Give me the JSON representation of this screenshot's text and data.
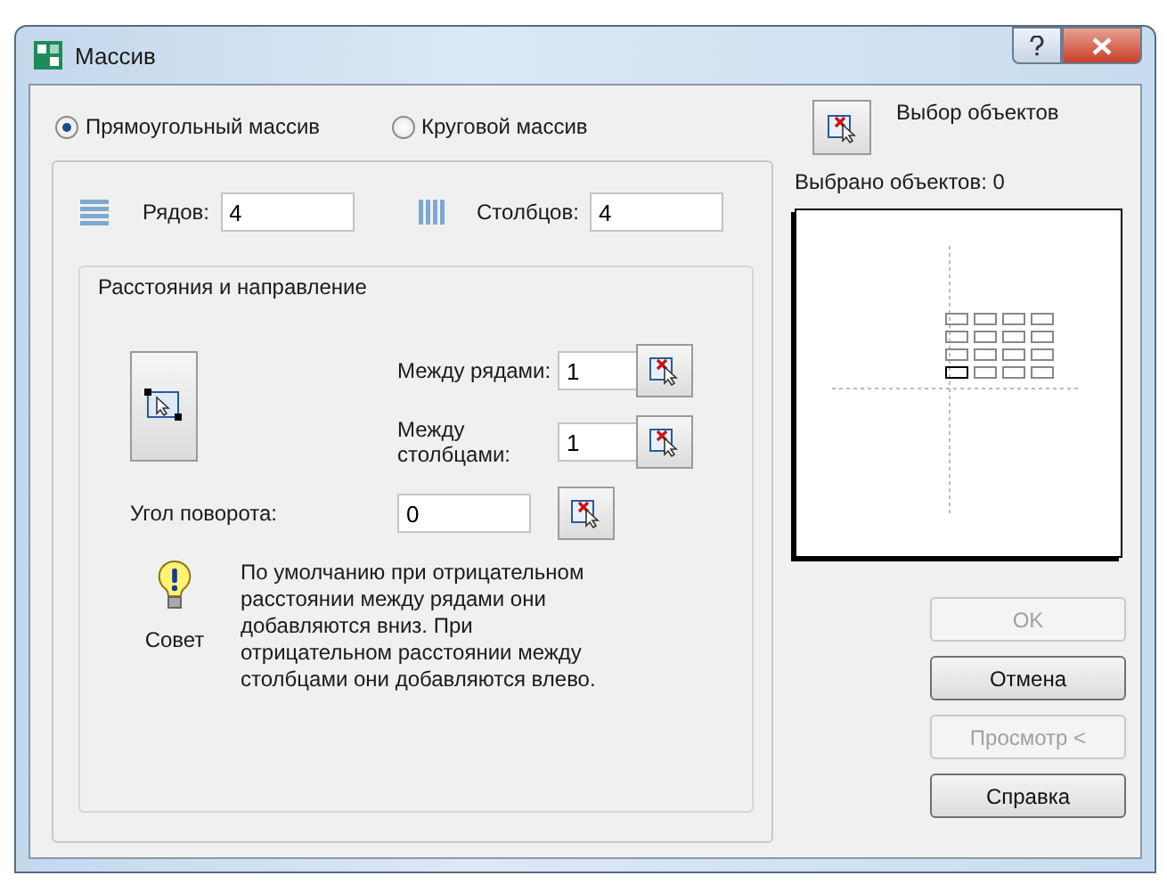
{
  "window": {
    "title": "Массив"
  },
  "array_type": [
    {
      "label": "Прямоугольный массив",
      "selected": true
    },
    {
      "label": "Круговой массив",
      "selected": false
    }
  ],
  "counts": [
    {
      "kind": "rows",
      "label": "Рядов:",
      "value": "4"
    },
    {
      "kind": "columns",
      "label": "Столбцов:",
      "value": "4"
    }
  ],
  "offsets": {
    "title": "Расстояния и направление",
    "fields": [
      {
        "label": "Между рядами:",
        "value": "1"
      },
      {
        "label": "Между столбцами:",
        "value": "1"
      },
      {
        "label": "Угол поворота:",
        "value": "0"
      }
    ]
  },
  "tip": {
    "label": "Совет",
    "text": "По умолчанию при отрицательном расстоянии между рядами они добавляются вниз. При отрицательном расстоянии между столбцами они добавляются влево."
  },
  "select_objects": {
    "label": "Выбор объектов",
    "count": "Выбрано объектов: 0"
  },
  "buttons": [
    {
      "label": "OK",
      "disabled": true
    },
    {
      "label": "Отмена",
      "disabled": false
    },
    {
      "label": "Просмотр <",
      "disabled": true
    },
    {
      "label": "Справка",
      "disabled": false
    }
  ]
}
